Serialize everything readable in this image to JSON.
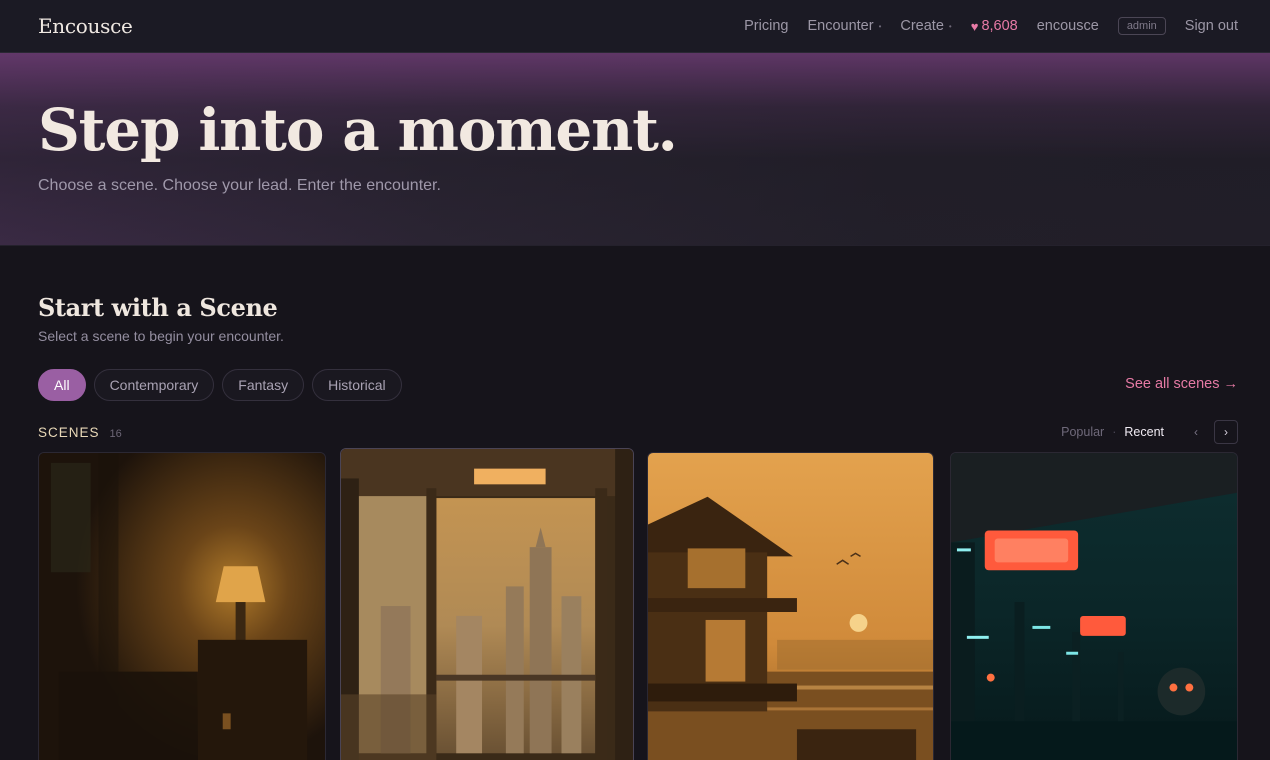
{
  "brand": "Encousce",
  "nav": {
    "pricing": "Pricing",
    "encounter": "Encounter",
    "create": "Create",
    "hearts": "8,608",
    "username": "encousce",
    "badge": "admin",
    "sign_out": "Sign out"
  },
  "hero": {
    "title": "Step into a moment.",
    "subtitle": "Choose a scene. Choose your lead. Enter the encounter."
  },
  "section": {
    "title": "Start with a Scene",
    "subtitle": "Select a scene to begin your encounter."
  },
  "filters": [
    {
      "label": "All",
      "active": true
    },
    {
      "label": "Contemporary",
      "active": false
    },
    {
      "label": "Fantasy",
      "active": false
    },
    {
      "label": "Historical",
      "active": false
    }
  ],
  "see_all": "See all scenes →",
  "scenes": {
    "label": "SCENES",
    "count": "16",
    "sort_popular": "Popular",
    "sort_recent": "Recent",
    "active_sort": "Recent",
    "prev": "‹",
    "next": "›"
  },
  "cards": [
    {
      "image": "dim-room-with-lamp"
    },
    {
      "image": "window-city-skyline"
    },
    {
      "image": "waterfront-house-sunset"
    },
    {
      "image": "neon-subway-platform"
    }
  ],
  "colors": {
    "accent": "#9a5fa3",
    "link": "#e67aa5",
    "background": "#16141b"
  }
}
